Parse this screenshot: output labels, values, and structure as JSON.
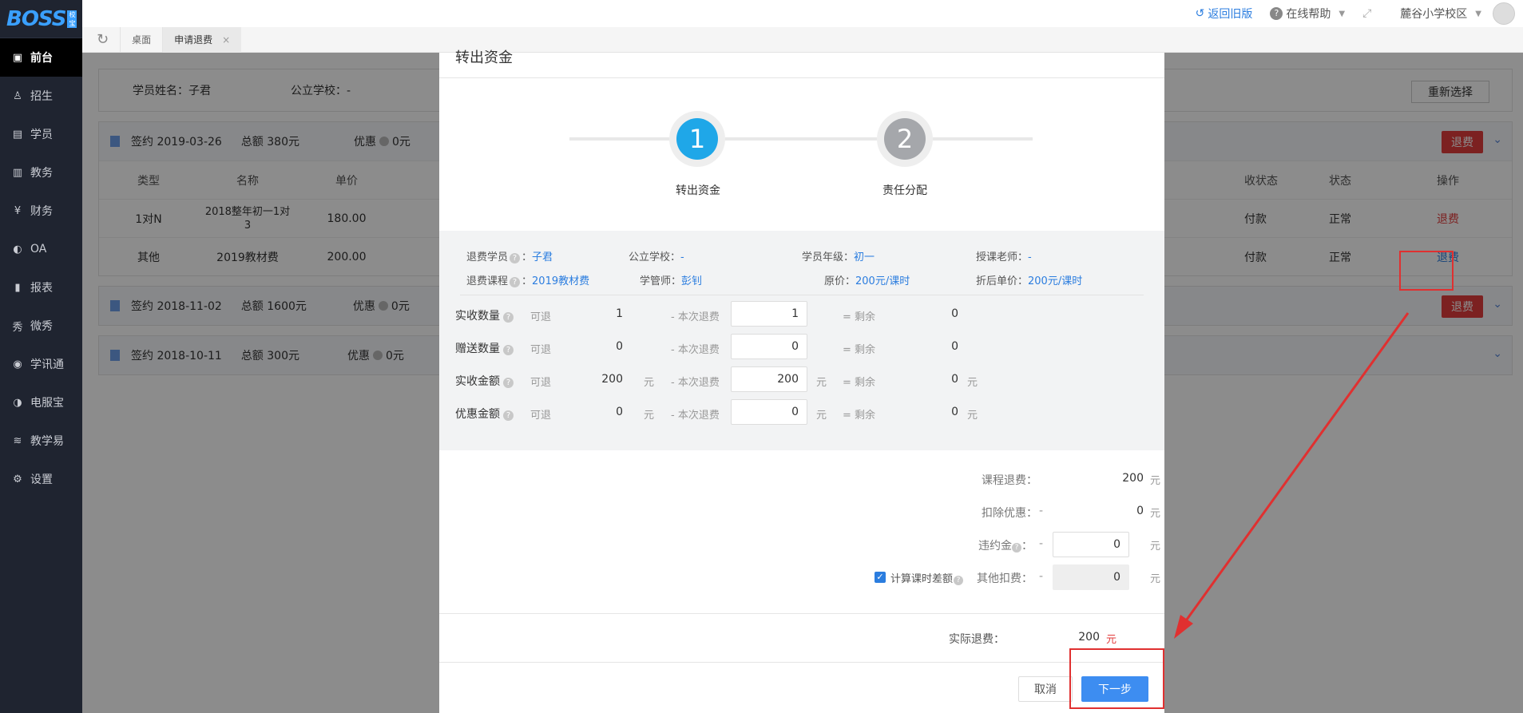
{
  "logo": {
    "text": "BOSS",
    "sub": "校宝"
  },
  "sidebar": {
    "items": [
      {
        "label": "前台",
        "icon": "calendar-icon",
        "glyph": "▣",
        "active": true
      },
      {
        "label": "招生",
        "icon": "user-plus-icon",
        "glyph": "♙"
      },
      {
        "label": "学员",
        "icon": "id-card-icon",
        "glyph": "▤"
      },
      {
        "label": "教务",
        "icon": "book-icon",
        "glyph": "▥"
      },
      {
        "label": "财务",
        "icon": "yen-icon",
        "glyph": "¥"
      },
      {
        "label": "OA",
        "icon": "toggle-icon",
        "glyph": "◐"
      },
      {
        "label": "报表",
        "icon": "bar-chart-icon",
        "glyph": "▮"
      },
      {
        "label": "微秀",
        "icon": "show-icon",
        "glyph": "秀"
      },
      {
        "label": "学讯通",
        "icon": "location-icon",
        "glyph": "◉"
      },
      {
        "label": "电服宝",
        "icon": "phone-icon",
        "glyph": "◑"
      },
      {
        "label": "教学易",
        "icon": "teach-icon",
        "glyph": "≋"
      },
      {
        "label": "设置",
        "icon": "gear-icon",
        "glyph": "⚙"
      }
    ]
  },
  "topbar": {
    "back_old": "返回旧版",
    "help": "在线帮助",
    "campus": "麓谷小学校区"
  },
  "tabs": [
    {
      "label": "桌面"
    },
    {
      "label": "申请退费",
      "active": true,
      "close": "×"
    }
  ],
  "main": {
    "student_label": "学员姓名：子君",
    "school_label": "公立学校：-",
    "reselect": "重新选择",
    "contracts": [
      {
        "sign": "签约 2019-03-26",
        "total": "总额 380元",
        "discount": "优惠",
        "discount_val": "0元",
        "refund_btn": "退费"
      },
      {
        "sign": "签约 2018-11-02",
        "total": "总额 1600元",
        "discount": "优惠",
        "discount_val": "0元",
        "refund_btn": "退费"
      },
      {
        "sign": "签约 2018-10-11",
        "total": "总额 300元",
        "discount": "优惠",
        "discount_val": "0元"
      }
    ],
    "table_headers": {
      "type": "类型",
      "name": "名称",
      "price": "单价",
      "pay_status": "收状态",
      "status": "状态",
      "op": "操作"
    },
    "rows": [
      {
        "type": "1对N",
        "name": "2018整年初一1对3",
        "price": "180.00",
        "pay": "付款",
        "status": "正常",
        "op": "退费"
      },
      {
        "type": "其他",
        "name": "2019教材费",
        "price": "200.00",
        "pay": "付款",
        "status": "正常",
        "op": "退费"
      }
    ]
  },
  "modal": {
    "title": "转出资金",
    "steps": [
      {
        "num": "1",
        "label": "转出资金"
      },
      {
        "num": "2",
        "label": "责任分配"
      }
    ],
    "info": {
      "student_k": "退费学员",
      "student_v": "子君",
      "school_k": "公立学校：",
      "school_v": "-",
      "grade_k": "学员年级：",
      "grade_v": "初一",
      "teacher_k": "授课老师：",
      "teacher_v": "-",
      "course_k": "退费课程",
      "course_v": "2019教材费",
      "manager_k": "学管师：",
      "manager_v": "彭钊",
      "orig_k": "原价：",
      "orig_v": "200元/课时",
      "disc_k": "折后单价：",
      "disc_v": "200元/课时"
    },
    "rows": [
      {
        "label": "实收数量",
        "refundable": "可退",
        "r_val": "1",
        "this": "- 本次退费",
        "input": "1",
        "remain": "= 剩余",
        "remain_val": "0",
        "unit": ""
      },
      {
        "label": "赠送数量",
        "refundable": "可退",
        "r_val": "0",
        "this": "- 本次退费",
        "input": "0",
        "remain": "= 剩余",
        "remain_val": "0",
        "unit": ""
      },
      {
        "label": "实收金额",
        "refundable": "可退",
        "r_val": "200",
        "this": "- 本次退费",
        "input": "200",
        "remain": "= 剩余",
        "remain_val": "0",
        "unit": "元"
      },
      {
        "label": "优惠金额",
        "refundable": "可退",
        "r_val": "0",
        "this": "- 本次退费",
        "input": "0",
        "remain": "= 剩余",
        "remain_val": "0",
        "unit": "元"
      }
    ],
    "summary": {
      "course_refund_k": "课程退费：",
      "course_refund_v": "200",
      "deduct_disc_k": "扣除优惠：",
      "deduct_disc_dash": "-",
      "deduct_disc_v": "0",
      "penalty_k": "违约金",
      "penalty_colon": "：",
      "penalty_dash": "-",
      "penalty_v": "0",
      "calc_diff": "计算课时差额",
      "other_k": "其他扣费：",
      "other_dash": "-",
      "other_v": "0",
      "unit": "元"
    },
    "actual_k": "实际退费：",
    "actual_v": "200",
    "actual_unit": "元",
    "cancel": "取消",
    "next": "下一步"
  }
}
